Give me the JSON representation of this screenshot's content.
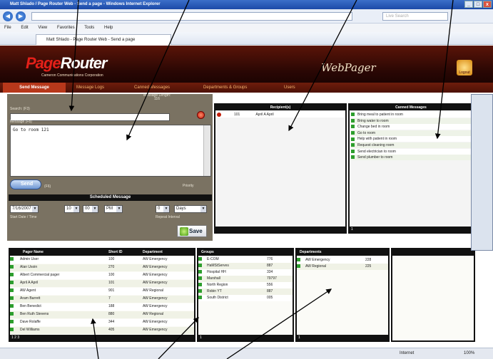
{
  "browser": {
    "title": "Matt Shlado / Page Router Web - Send a page - Windows Internet Explorer",
    "address": "",
    "search_placeholder": "Live Search",
    "menu": [
      "File",
      "Edit",
      "View",
      "Favorites",
      "Tools",
      "Help"
    ],
    "tab_label": "Matt Shlado - Page Router Web - Send a page",
    "status_zone": "Internet",
    "zoom": "100%"
  },
  "app": {
    "logo_p": "Page",
    "logo_rest": "Router",
    "logo_sub": "Cameron Communications Corporation",
    "product": "WebPager",
    "logout": "Logout"
  },
  "nav": {
    "send": "Send Message",
    "logs": "Message Logs",
    "canned": "Canned Messages",
    "depts": "Departments & Groups",
    "users": "Users"
  },
  "form": {
    "search_label": "Search: (F3)",
    "msglen_label": "Message Length: 116",
    "message_label": "Message (F8)",
    "message_text": "Go to room 121",
    "send_label": "Send",
    "chars_label": "(F6)",
    "priority_label": "Priority",
    "schedule_header": "Scheduled Message",
    "date": "7/16/2007",
    "hour": "10",
    "minute": "00",
    "ampm": "PM",
    "repeat_count": "0",
    "repeat_unit": "Days",
    "date_note": "Start Date / Time",
    "repeat_note": "Repeat Interval",
    "save_label": "Save"
  },
  "recipients": {
    "header": "Recipient(s)",
    "items": [
      {
        "id": "101",
        "name": "April A April"
      }
    ]
  },
  "canned": {
    "header": "Canned Messages",
    "items": [
      "Bring meal to patient in room",
      "Bring water to room",
      "Change bed in room",
      "Go to room",
      "Help with patient in room",
      "Request cleaning room",
      "Send electrician to room",
      "Send plumber to room"
    ],
    "footer": "1"
  },
  "pagers": {
    "headers": [
      "Pager Name",
      "Short ID",
      "Department"
    ],
    "rows": [
      [
        "Admin User",
        "100",
        "AW Emergency"
      ],
      [
        "Alan Usoin",
        "270",
        "AW Emergency"
      ],
      [
        "Albert Commercial pager",
        "100",
        "AW Emergency"
      ],
      [
        "April A April",
        "101",
        "AW Emergency"
      ],
      [
        "AW Agent",
        "901",
        "AW Regional"
      ],
      [
        "Aram Barrett",
        "7",
        "AW Emergency"
      ],
      [
        "Ben Benedict",
        "188",
        "AW Emergency"
      ],
      [
        "Ben Ruth Stevens",
        "880",
        "AW Regional"
      ],
      [
        "Dave Rolaffe",
        "344",
        "AW Emergency"
      ],
      [
        "Del Williams",
        "405",
        "AW Emergency"
      ]
    ],
    "footer": "1 2 3"
  },
  "groups": {
    "header": "Groups",
    "rows": [
      [
        "E-COM",
        "776"
      ],
      [
        "HaMStServes",
        "887"
      ],
      [
        "Hospital HH",
        "334"
      ],
      [
        "Marshall",
        "79797"
      ],
      [
        "North Region",
        "556"
      ],
      [
        "Robin YT",
        "887"
      ],
      [
        "South District",
        "005"
      ]
    ],
    "footer": "1"
  },
  "departments": {
    "header": "Departments",
    "rows": [
      [
        "AW Emergency",
        "228"
      ],
      [
        "AW Regional",
        "225"
      ]
    ],
    "footer": "1"
  }
}
